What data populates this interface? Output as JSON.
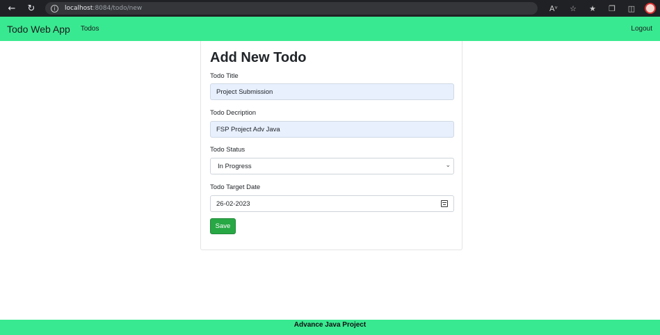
{
  "browser": {
    "url_host": "localhost",
    "url_path": ":8084/todo/new",
    "icons": [
      "back-icon",
      "reload-icon",
      "info-icon",
      "read-aloud-icon",
      "add-favorite-icon",
      "favorites-icon",
      "collections-icon",
      "extensions-icon",
      "profile-icon"
    ]
  },
  "navbar": {
    "brand": "Todo Web App",
    "link_todos": "Todos",
    "logout": "Logout",
    "color": "#39e991"
  },
  "form": {
    "title": "Add New Todo",
    "title_label": "Todo Title",
    "title_value": "Project Submission",
    "description_label": "Todo Decription",
    "description_value": "FSP Project Adv Java",
    "status_label": "Todo Status",
    "status_value": "In Progress",
    "date_label": "Todo Target Date",
    "date_value": "26-02-2023",
    "save_label": "Save",
    "save_color": "#28a745"
  },
  "footer": {
    "text": "Advance Java Project"
  }
}
